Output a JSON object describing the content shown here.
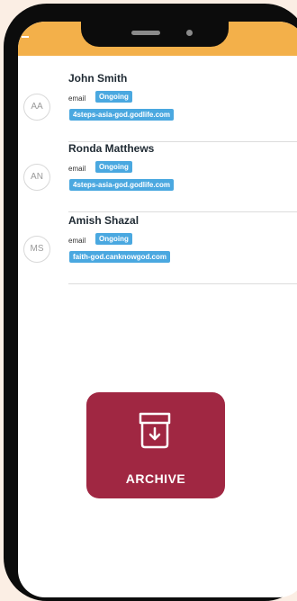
{
  "contacts": [
    {
      "initials": "AA",
      "name": "John Smith",
      "email_label": "email",
      "status": "Ongoing",
      "domain": "4steps-asia-god.godlife.com"
    },
    {
      "initials": "AN",
      "name": "Ronda Matthews",
      "email_label": "email",
      "status": "Ongoing",
      "domain": "4steps-asia-god.godlife.com"
    },
    {
      "initials": "MS",
      "name": "Amish Shazal",
      "email_label": "email",
      "status": "Ongoing",
      "domain": "faith-god.canknowgod.com"
    }
  ],
  "archive": {
    "label": "ARCHIVE",
    "icon": "archive-box-icon"
  },
  "colors": {
    "header": "#f3b04a",
    "badge": "#4aa8e0",
    "archive": "#a02742"
  }
}
